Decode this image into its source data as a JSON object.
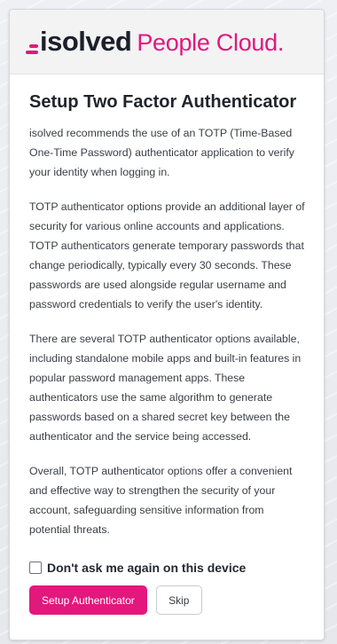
{
  "brand": {
    "name": "isolved",
    "product": "People Cloud.",
    "accent_color": "#e2187d",
    "logo_icon": "isolved-logo-mark"
  },
  "dialog": {
    "title": "Setup Two Factor Authenticator",
    "paragraphs": [
      "isolved recommends the use of an TOTP (Time-Based One-Time Password) authenticator application to verify your identity when logging in.",
      "TOTP authenticator options provide an additional layer of security for various online accounts and applications. TOTP authenticators generate temporary passwords that change periodically, typically every 30 seconds. These passwords are used alongside regular username and password credentials to verify the user's identity.",
      "There are several TOTP authenticator options available, including standalone mobile apps and built-in features in popular password management apps. These authenticators use the same algorithm to generate passwords based on a shared secret key between the authenticator and the service being accessed.",
      "Overall, TOTP authenticator options offer a convenient and effective way to strengthen the security of your account, safeguarding sensitive information from potential threats."
    ],
    "checkbox": {
      "label": "Don't ask me again on this device",
      "checked": false
    },
    "buttons": {
      "primary_label": "Setup Authenticator",
      "secondary_label": "Skip"
    }
  }
}
